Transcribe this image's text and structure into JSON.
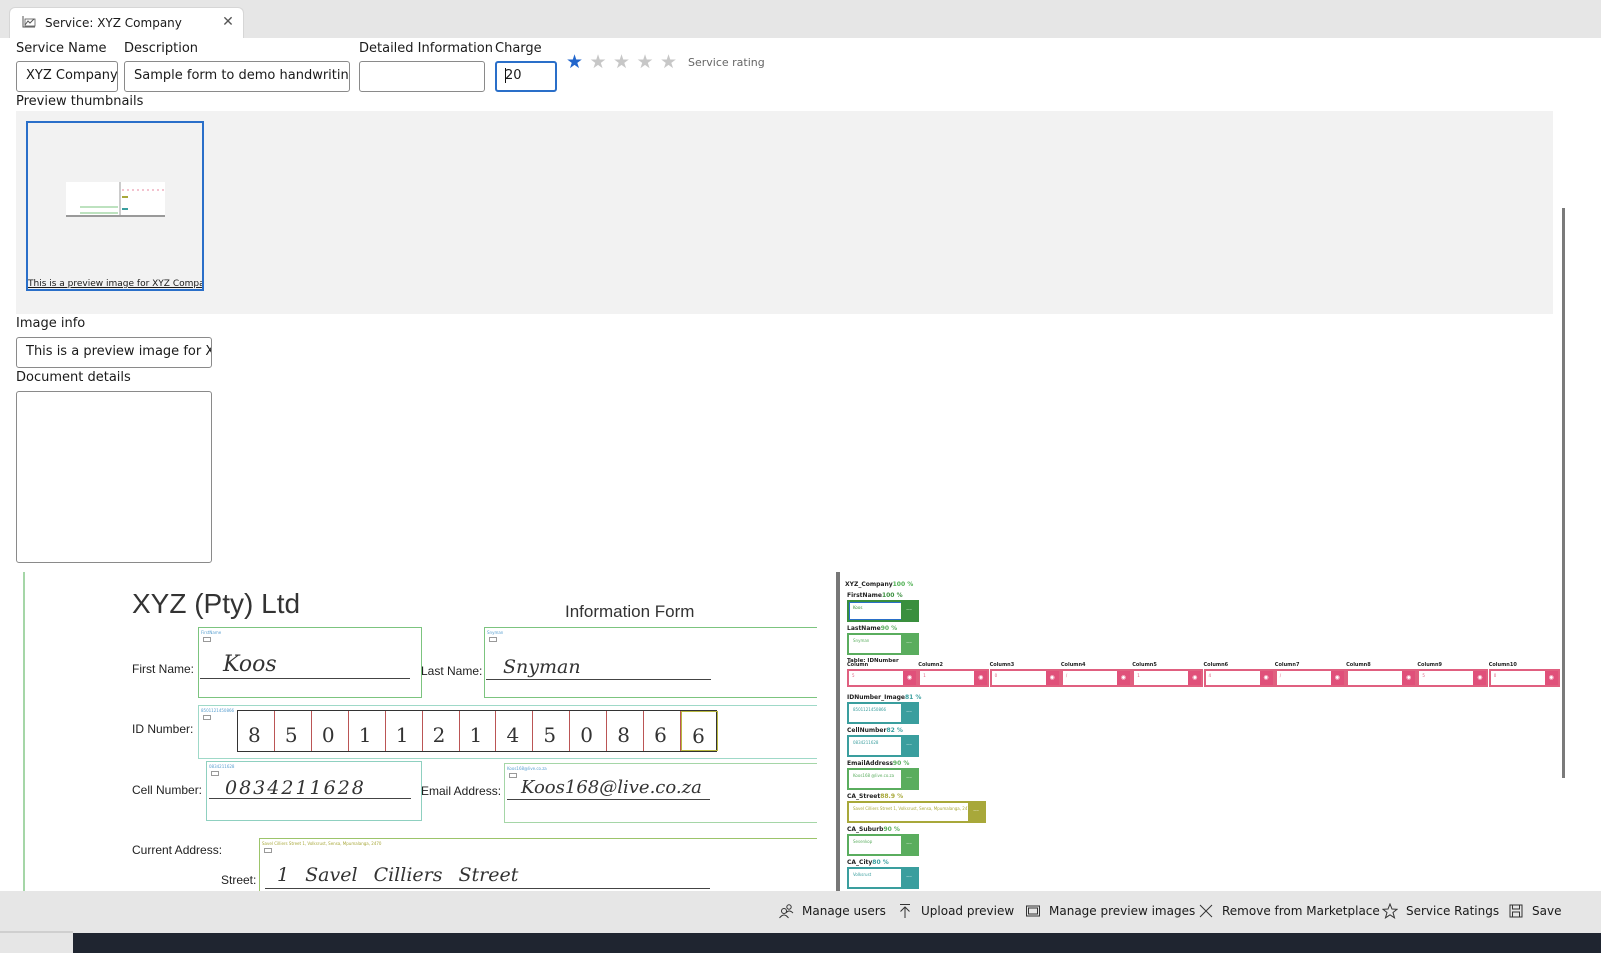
{
  "tab": {
    "title": "Service: XYZ Company",
    "icon": "chart-icon",
    "close_icon": "close-icon"
  },
  "fields": {
    "service_name": {
      "label": "Service Name",
      "value": "XYZ Company"
    },
    "description": {
      "label": "Description",
      "value": "Sample form to demo handwriting"
    },
    "detailed_info": {
      "label": "Detailed Information",
      "value": ""
    },
    "charge": {
      "label": "Charge",
      "value": "20"
    }
  },
  "rating": {
    "value": 1,
    "max": 5,
    "label": "Service rating",
    "on_color": "#2266cc",
    "off_color": "#c7c7c7"
  },
  "preview": {
    "section_label": "Preview thumbnails",
    "thumbnails": [
      {
        "caption": "This is a preview image for XYZ Company",
        "selected": true
      }
    ]
  },
  "image_info": {
    "label": "Image info",
    "value": "This is a preview image for XYZ Company"
  },
  "document_details": {
    "label": "Document details",
    "value": ""
  },
  "document": {
    "company": "XYZ (Pty) Ltd",
    "form_title": "Information Form",
    "labels": {
      "first_name": "First Name:",
      "last_name": "Last Name:",
      "id_number": "ID Number:",
      "cell_number": "Cell Number:",
      "email": "Email Address:",
      "current_address": "Current Address:",
      "street": "Street:"
    },
    "handwriting": {
      "first_name": "Koos",
      "last_name": "Snyman",
      "cell_number": "0834211628",
      "email": "Koos168@live.co.za",
      "street": "1 Savel Cilliers Street"
    },
    "id_digits": [
      "8",
      "5",
      "0",
      "1",
      "1",
      "2",
      "1",
      "4",
      "5",
      "0",
      "8",
      "6",
      "6"
    ]
  },
  "ocr": {
    "root": {
      "name": "XYZ_Company",
      "pct": "100 %"
    },
    "fields": [
      {
        "name": "FirstName",
        "pct": "100 %",
        "value": "Koos",
        "color": "#3a8f3e"
      },
      {
        "name": "LastName",
        "pct": "90 %",
        "value": "Snyman",
        "color": "#5aad5e"
      },
      {
        "name": "IDNumber_Image",
        "pct": "81 %",
        "value": "8501121450866",
        "color": "#3a9e9e"
      },
      {
        "name": "CellNumber",
        "pct": "82 %",
        "value": "0834211628",
        "color": "#3a9e9e"
      },
      {
        "name": "EmailAddress",
        "pct": "90 %",
        "value": "Koos168 @live.co.za",
        "color": "#5aad5e"
      },
      {
        "name": "CA_Street",
        "pct": "88.9 %",
        "value": "Savel Cilliers Street 1, Volksrust, Sensa, Mpumalanga, 2470",
        "color": "#a8a83a"
      },
      {
        "name": "CA_Suburb",
        "pct": "90 %",
        "value": "Sesenkop",
        "color": "#5aad5e"
      },
      {
        "name": "CA_City",
        "pct": "80 %",
        "value": "Volksrust",
        "color": "#3a9e9e"
      }
    ],
    "table": {
      "title": "Table: IDNumber",
      "columns": [
        {
          "name": "Column",
          "value": "5"
        },
        {
          "name": "Column2",
          "value": "1"
        },
        {
          "name": "Column3",
          "value": "0"
        },
        {
          "name": "Column4",
          "value": "/"
        },
        {
          "name": "Column5",
          "value": "1"
        },
        {
          "name": "Column6",
          "value": "4"
        },
        {
          "name": "Column7",
          "value": "/"
        },
        {
          "name": "Column8",
          "value": ""
        },
        {
          "name": "Column9",
          "value": "5"
        },
        {
          "name": "Column10",
          "value": "0"
        }
      ]
    }
  },
  "commands": [
    {
      "label": "Manage users",
      "icon": "users-icon"
    },
    {
      "label": "Upload preview",
      "icon": "upload-icon"
    },
    {
      "label": "Manage preview images",
      "icon": "images-icon"
    },
    {
      "label": "Remove from Marketplace",
      "icon": "close-icon"
    },
    {
      "label": "Service Ratings",
      "icon": "star-icon"
    },
    {
      "label": "Save",
      "icon": "save-icon"
    }
  ]
}
